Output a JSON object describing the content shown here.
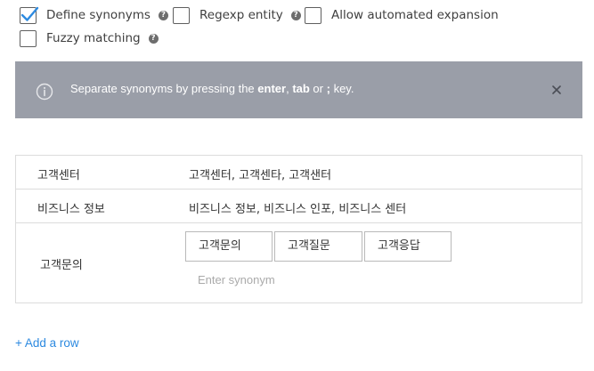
{
  "options": [
    {
      "label": "Define synonyms",
      "checked": true,
      "help_icon": "question-circle-icon"
    },
    {
      "label": "Regexp entity",
      "checked": false,
      "help_icon": "question-circle-icon"
    },
    {
      "label": "Allow automated expansion",
      "checked": false
    },
    {
      "label": "Fuzzy matching",
      "checked": false,
      "help_icon": "question-circle-icon"
    }
  ],
  "help_glyph": "?",
  "banner": {
    "text_before": "Separate synonyms by pressing the ",
    "key_enter": "enter",
    "sep_comma": ", ",
    "key_tab": "tab",
    "text_or": " or ",
    "key_semicolon": ";",
    "text_after": " key.",
    "icon": "info-icon",
    "close_icon": "close-icon"
  },
  "entries": [
    {
      "name": "고객센터",
      "synonyms": "고객센터, 고객센타, 고객샌터"
    },
    {
      "name": "비즈니스 정보",
      "synonyms": "비즈니스 정보, 비즈니스 인포, 비즈니스 센터"
    },
    {
      "name": "고객문의",
      "chips": [
        "고객문의",
        "고객질문",
        "고객응답"
      ],
      "input_placeholder": "Enter synonym"
    }
  ],
  "add_row_label": "+ Add a row",
  "colors": {
    "checkbox_checked": "#2d8ae0",
    "banner_bg": "#9a9ea8",
    "link": "#2d8ae0",
    "border": "#dcdcdc"
  }
}
